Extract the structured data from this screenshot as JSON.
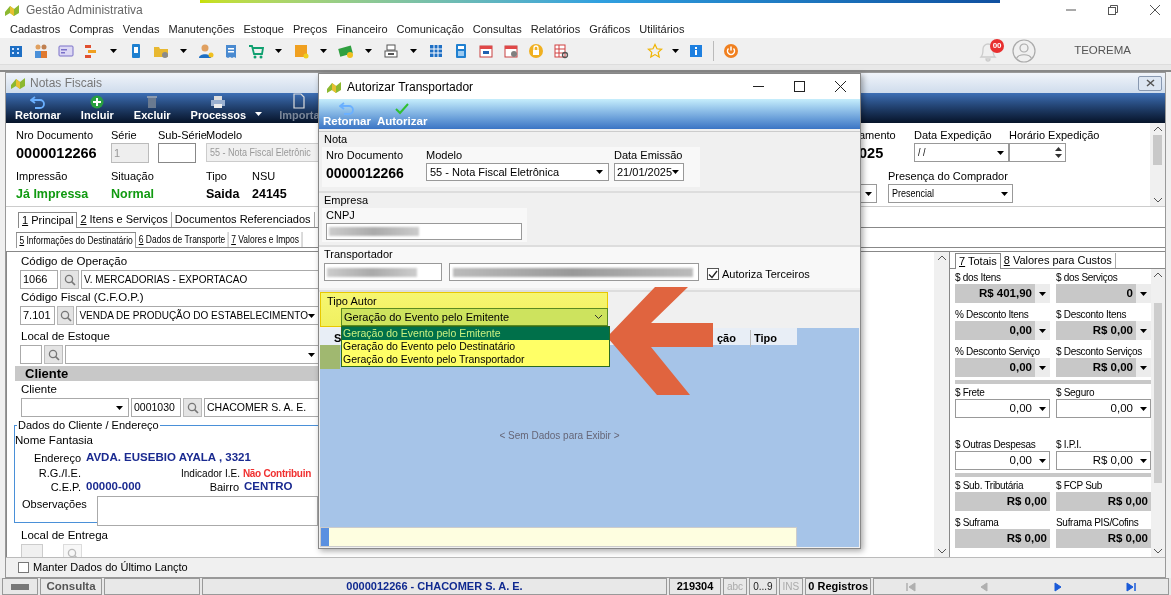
{
  "app": {
    "title": "Gestão Administrativa",
    "notification_count": "00",
    "user": "TEOREMA"
  },
  "menu": [
    "Cadastros",
    "Compras",
    "Vendas",
    "Manutenções",
    "Estoque",
    "Preços",
    "Financeiro",
    "Comunicação",
    "Consultas",
    "Relatórios",
    "Gráficos",
    "Utilitários"
  ],
  "main_window": {
    "title": "Notas Fiscais",
    "toolbar": [
      {
        "label": "Retornar",
        "kind": "back",
        "disabled": false
      },
      {
        "label": "Incluir",
        "kind": "add",
        "disabled": false
      },
      {
        "label": "Excluir",
        "kind": "delete",
        "disabled": false
      },
      {
        "label": "Processos",
        "kind": "print",
        "disabled": false
      },
      {
        "label": "Importa",
        "kind": "import",
        "disabled": true
      }
    ],
    "header_left": [
      [
        {
          "label": "Nro Documento",
          "value": "0000012266",
          "kind": "number"
        },
        {
          "label": "Série",
          "value": "1",
          "kind": "input",
          "disabled": true
        },
        {
          "label": "Sub-Série",
          "kind": "input",
          "disabled": false
        },
        {
          "label": "Modelo",
          "value": "55 - Nota Fiscal Eletrônic",
          "kind": "select",
          "disabled": true
        }
      ],
      [
        {
          "label": "Impressão",
          "value": "Já Impressa",
          "kind": "status"
        },
        {
          "label": "Situação",
          "value": "Normal",
          "kind": "status"
        },
        {
          "label": "Tipo",
          "value": "Saida",
          "kind": "text"
        },
        {
          "label": "NSU",
          "value": "24145",
          "kind": "text"
        }
      ]
    ],
    "header_right": [
      [
        {
          "label": "amento",
          "value": "025",
          "kind": "number"
        },
        {
          "label": "Data Expedição",
          "value": "/ /",
          "kind": "select",
          "disabled": false
        },
        {
          "label": "Horário Expedição",
          "kind": "spinner"
        }
      ],
      [
        {
          "label": "Presença do Comprador",
          "value": "Presencial",
          "kind": "select",
          "disabled": false
        }
      ]
    ],
    "tabs": [
      {
        "key": "1",
        "label": " Principal",
        "selected": true
      },
      {
        "key": "2",
        "label": " Itens e Serviços",
        "selected": false
      },
      {
        "label": "Documentos Referenciados",
        "selected": false
      }
    ],
    "subtabs": [
      {
        "key": "5",
        "label": " Informações do Destinatário",
        "selected": true
      },
      {
        "key": "6",
        "label": " Dados de Transporte",
        "selected": false
      },
      {
        "key": "7",
        "label": " Valores e Impos",
        "selected": false
      }
    ],
    "form": {
      "operacao": {
        "label": "Código de Operação",
        "code": "1066",
        "description": "V. MERCADORIAS - EXPORTACAO"
      },
      "cfop": {
        "label": "Código Fiscal (C.F.O.P.)",
        "code": "7.101",
        "description": "VENDA DE PRODUÇÃO DO ESTABELECIMENTO"
      },
      "local_estoque": {
        "label": "Local de Estoque"
      },
      "section": "Cliente",
      "cliente": {
        "label": "Cliente",
        "code": "0001030",
        "name": "CHACOMER S. A. E."
      },
      "dados_cliente": {
        "title": "Dados do Cliente / Endereço",
        "nome_fantasia": "Nome Fantasia",
        "endereco_label": "Endereço",
        "endereco": "AVDA. EUSEBIO AYALA , 3321",
        "rg_label": "R.G./I.E.",
        "indicador_label": "Indicador I.E.",
        "indicador": "Não Contribuin",
        "cep_label": "C.E.P.",
        "cep": "00000-000",
        "bairro_label": "Bairro",
        "bairro": "CENTRO",
        "observacoes_label": "Observações"
      },
      "local_entrega": {
        "label": "Local de Entrega"
      },
      "keep_last": {
        "label": "Manter Dados do Último Lançto",
        "checked": false
      }
    },
    "totals": {
      "tabs": [
        {
          "key": "7",
          "label": " Totais",
          "selected": true
        },
        {
          "key": "8",
          "label": " Valores para Custos",
          "selected": false
        }
      ],
      "groups": [
        [
          {
            "label": "$ dos Itens",
            "value": "R$ 401,90",
            "kind": "readonly_dropdown"
          },
          {
            "label": "$ dos Serviços",
            "value": "0",
            "kind": "readonly_dropdown"
          },
          {
            "label": "% Desconto Itens",
            "value": "0,00",
            "kind": "readonly_dropdown"
          },
          {
            "label": "$ Desconto Itens",
            "value": "R$ 0,00",
            "kind": "readonly_dropdown"
          },
          {
            "label": "% Desconto Serviço",
            "value": "0,00",
            "kind": "readonly_dropdown"
          },
          {
            "label": "$ Desconto Serviços",
            "value": "R$ 0,00",
            "kind": "readonly_dropdown"
          }
        ],
        [
          {
            "label": "$ Frete",
            "value": "0,00",
            "kind": "input_dropdown"
          },
          {
            "label": "$ Seguro",
            "value": "0,00",
            "kind": "input_dropdown"
          },
          {
            "label": "$ Outras Despesas",
            "value": "0,00",
            "kind": "input_dropdown"
          },
          {
            "label": "$ I.P.I.",
            "value": "R$ 0,00",
            "kind": "input_dropdown"
          }
        ],
        [
          {
            "label": "$ Sub. Tributária",
            "value": "R$ 0,00",
            "kind": "readonly"
          },
          {
            "label": "$ FCP Sub",
            "value": "R$ 0,00",
            "kind": "readonly"
          },
          {
            "label": "$ Suframa",
            "value": "R$ 0,00",
            "kind": "readonly"
          },
          {
            "label": "Suframa PIS/Cofins",
            "value": "R$ 0,00",
            "kind": "readonly"
          }
        ]
      ]
    }
  },
  "status_bar": {
    "mode": "Consulta",
    "record": "0000012266 - CHACOMER S. A. E.",
    "number": "219304",
    "indicators": [
      {
        "label": "abc",
        "on": false
      },
      {
        "label": "0...9",
        "on": true
      },
      {
        "label": "INS",
        "on": false
      }
    ],
    "count": "0 Registros",
    "nav": [
      {
        "kind": "first",
        "disabled": true
      },
      {
        "kind": "prev",
        "disabled": true
      },
      {
        "kind": "next",
        "disabled": false
      },
      {
        "kind": "last",
        "disabled": false
      }
    ]
  },
  "dialog": {
    "title": "Autorizar Transportador",
    "toolbar": [
      {
        "label": "Retornar",
        "kind": "back"
      },
      {
        "label": "Autorizar",
        "kind": "confirm"
      }
    ],
    "nota": {
      "title": "Nota",
      "nro_label": "Nro Documento",
      "nro": "0000012266",
      "modelo_label": "Modelo",
      "modelo": "55 - Nota Fiscal Eletrônica",
      "data_label": "Data Emissão",
      "data": "21/01/2025"
    },
    "empresa": {
      "title": "Empresa",
      "cnpj_label": "CNPJ"
    },
    "transportador": {
      "title": "Transportador",
      "autoriza_terceiros": {
        "label": "Autoriza Terceiros",
        "checked": true
      }
    },
    "tipo_autor": {
      "label": "Tipo Autor",
      "value": "Geração do Evento pelo Emitente",
      "expanded": true,
      "options": [
        {
          "label": "Geração do Evento pelo Emitente",
          "selected": true
        },
        {
          "label": "Geração do Evento pelo Destinatário",
          "selected": false
        },
        {
          "label": "Geração do Evento pelo Transportador",
          "selected": false
        }
      ]
    },
    "grid": {
      "column_1": "S",
      "column_2": "ção",
      "column_3": "Tipo",
      "empty_text": "< Sem Dados para Exibir >"
    }
  }
}
